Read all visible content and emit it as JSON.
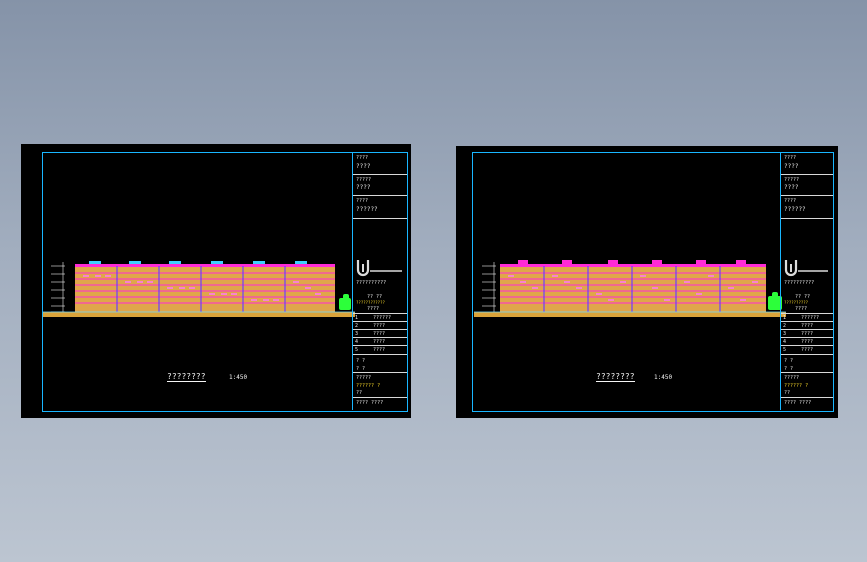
{
  "sheets": [
    {
      "drawing_title": "????????",
      "scale": "1:450",
      "titleblock": {
        "rows": [
          "????",
          "????",
          "?????",
          "????",
          "????",
          "??????"
        ],
        "company_line": "??????????",
        "mid_rows": [
          "??  ??",
          "????????????",
          "????"
        ],
        "list_items": [
          {
            "code": "1",
            "value": "??????"
          },
          {
            "code": "2",
            "value": "????"
          },
          {
            "code": "3",
            "value": "????"
          },
          {
            "code": "4",
            "value": "????"
          },
          {
            "code": "5",
            "value": "????"
          }
        ],
        "sign_rows": [
          "?  ?",
          "?  ?",
          "?????",
          "?????? ?",
          "??"
        ],
        "footer": "????  ????"
      }
    },
    {
      "drawing_title": "????????",
      "scale": "1:450",
      "titleblock": {
        "rows": [
          "????",
          "????",
          "?????",
          "????",
          "????",
          "??????"
        ],
        "company_line": "??????????",
        "mid_rows": [
          "??  ??",
          "??????????",
          "????"
        ],
        "list_items": [
          {
            "code": "1",
            "value": "??????"
          },
          {
            "code": "2",
            "value": "????"
          },
          {
            "code": "3",
            "value": "????"
          },
          {
            "code": "4",
            "value": "????"
          },
          {
            "code": "5",
            "value": "????"
          }
        ],
        "sign_rows": [
          "?  ?",
          "?  ?",
          "?????",
          "?????? ?",
          "??"
        ],
        "footer": "????  ????"
      }
    }
  ],
  "colors": {
    "background_top": "#8593a8",
    "background_bottom": "#bcc5d1",
    "sheet": "#000000",
    "frame": "#19b6ff",
    "building_fill": "#e0a64a",
    "building_lines": "#ff2bd6",
    "ground": "#d9a33a",
    "tree": "#2cff3a",
    "text": "#e8e8e8"
  },
  "icons": [
    "designer-logo-icon"
  ]
}
